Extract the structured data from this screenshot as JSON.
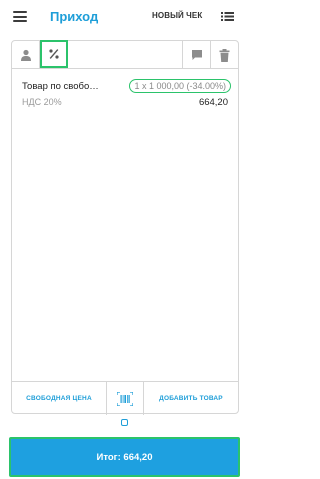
{
  "header": {
    "title": "Приход",
    "new_check_label": "НОВЫЙ ЧЕК",
    "menu_icon": "hamburger-menu-icon",
    "list_icon": "list-icon"
  },
  "toolbar": {
    "user_icon": "user-icon",
    "discount_icon": "percent-icon",
    "comment_icon": "comment-icon",
    "delete_icon": "trash-icon"
  },
  "items": [
    {
      "name": "Товар по свобо…",
      "quantity_price": "1 x 1 000,00 (-34.00%)",
      "vat": "НДС 20%",
      "sum": "664,20"
    }
  ],
  "actions": {
    "free_price_label": "СВОБОДНАЯ ЦЕНА",
    "scan_icon": "barcode-scan-icon",
    "add_product_label": "ДОБАВИТЬ ТОВАР"
  },
  "total": {
    "label": "Итог: 664,20"
  },
  "colors": {
    "accent": "#1e9ed8",
    "highlight": "#2bc36b"
  }
}
